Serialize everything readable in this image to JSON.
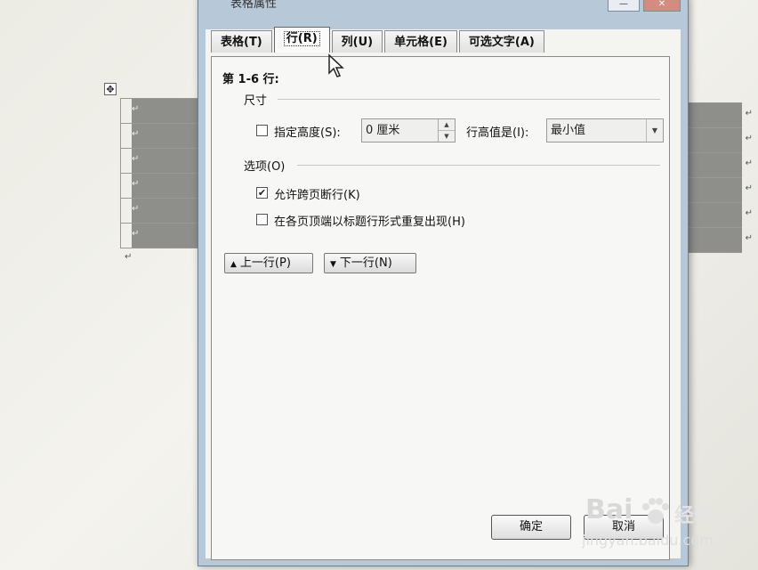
{
  "document": {
    "move_handle_glyph": "✥",
    "para_mark": "↵",
    "left_table_rows": 6,
    "right_table_rows": 6
  },
  "dialog": {
    "title": "表格属性",
    "sys_buttons": {
      "minimize": "—",
      "close": "✕"
    },
    "tabs": [
      {
        "label": "表格(T)",
        "active": false
      },
      {
        "label": "行(R)",
        "active": true
      },
      {
        "label": "列(U)",
        "active": false
      },
      {
        "label": "单元格(E)",
        "active": false
      },
      {
        "label": "可选文字(A)",
        "active": false
      }
    ],
    "rows_label": "第 1-6 行:",
    "size_section": "尺寸",
    "specify_height": {
      "label": "指定高度(S):",
      "checked": false
    },
    "height_value": "0 厘米",
    "row_height_is_label": "行高值是(I):",
    "row_height_is_value": "最小值",
    "options_section": "选项(O)",
    "allow_break": {
      "label": "允许跨页断行(K)",
      "checked": true
    },
    "repeat_header": {
      "label": "在各页顶端以标题行形式重复出现(H)",
      "checked": false
    },
    "prev_row_button": "上一行(P)",
    "next_row_button": "下一行(N)",
    "ok_button": "确定",
    "cancel_button": "取消"
  },
  "watermark": {
    "logo": "Bai",
    "brand": "经验",
    "url": "jingyan.baidu.com"
  }
}
